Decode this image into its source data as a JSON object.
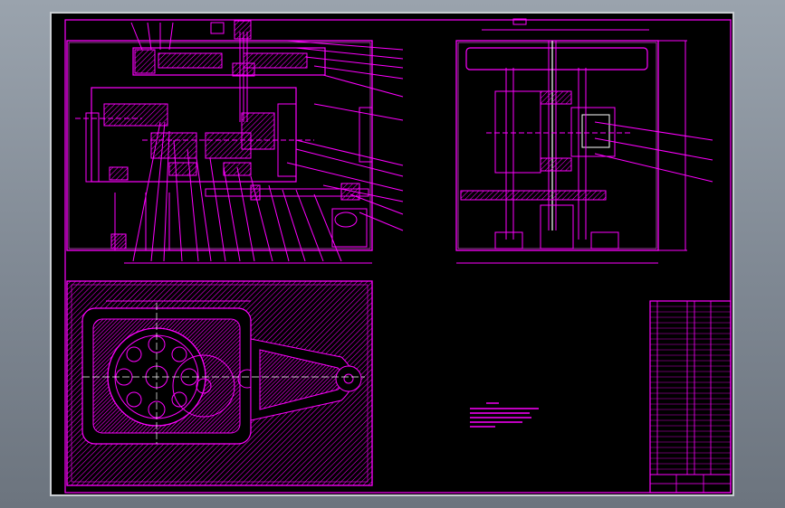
{
  "drawing": {
    "sheet_color": "#000000",
    "line_color": "#ff00ff",
    "white_line_color": "#ffffff",
    "viewport_bg": "#8a939d"
  },
  "notes": {
    "heading": "",
    "lines": []
  },
  "title_block": {
    "rows": []
  }
}
